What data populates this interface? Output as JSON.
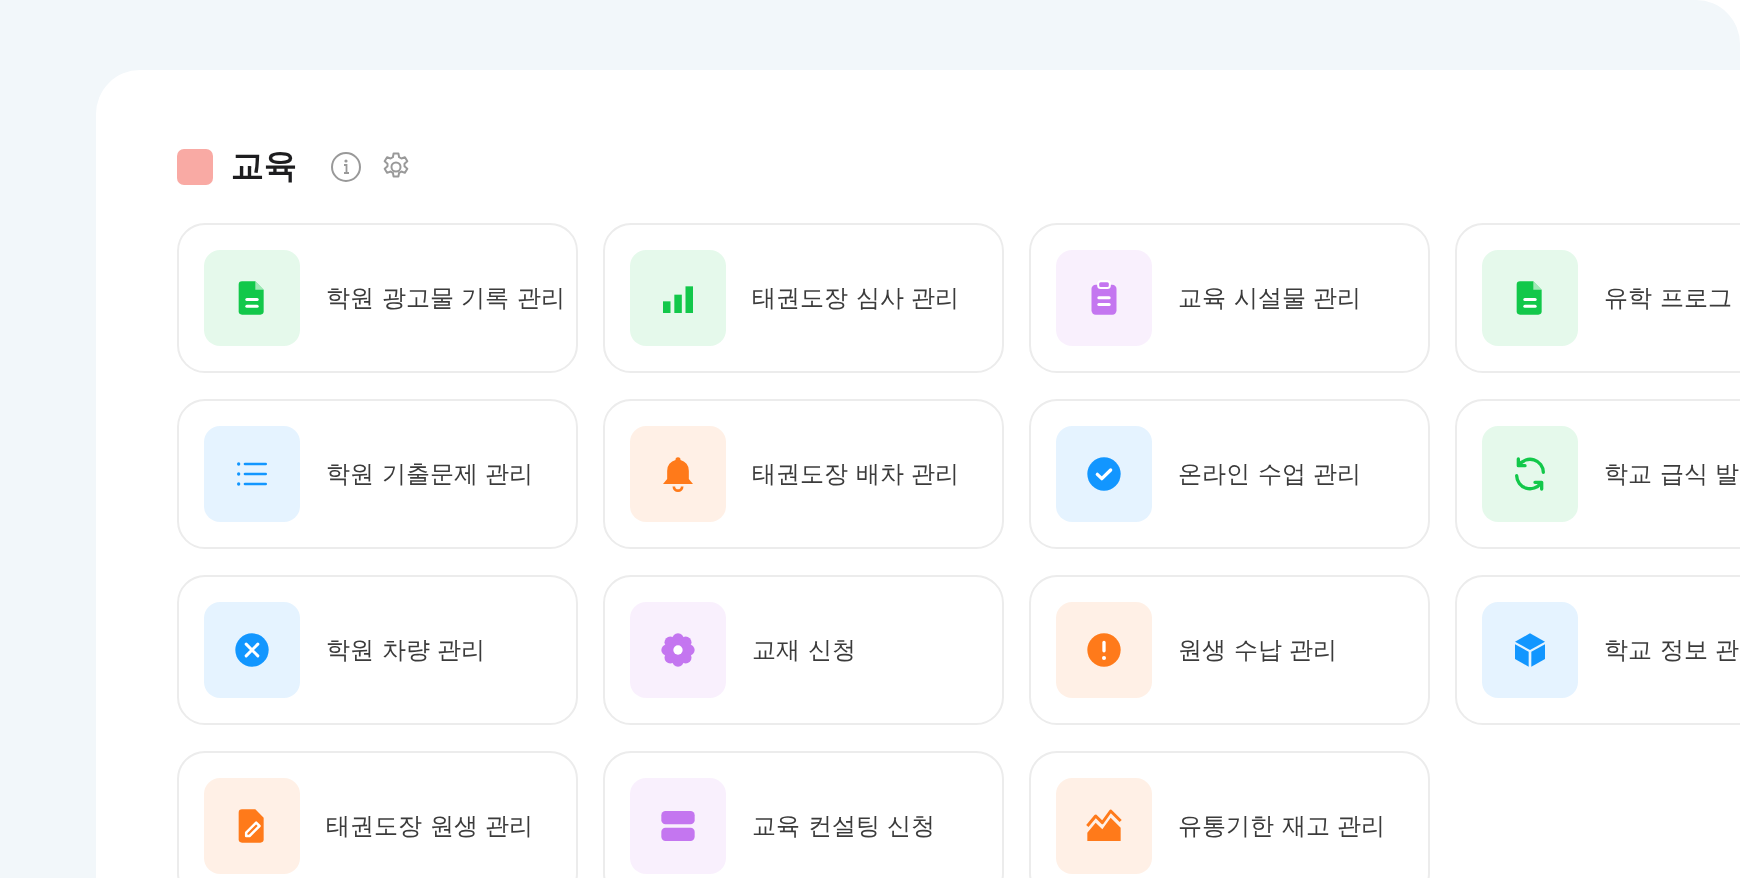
{
  "section": {
    "title": "교육",
    "color": "#f9aaa4"
  },
  "items": [
    {
      "label": "학원 광고물 기록 관리",
      "kind": "document",
      "color": "#12c84a"
    },
    {
      "label": "태권도장 심사 관리",
      "kind": "bars",
      "color": "#12c84a"
    },
    {
      "label": "교육 시설물 관리",
      "kind": "clipboard",
      "color": "#c476f0"
    },
    {
      "label": "유학 프로그",
      "kind": "document",
      "color": "#12c84a"
    },
    {
      "label": "학원 기출문제 관리",
      "kind": "list",
      "color": "#1296ff"
    },
    {
      "label": "태권도장 배차 관리",
      "kind": "bell",
      "color": "#ff7a1a"
    },
    {
      "label": "온라인 수업 관리",
      "kind": "check",
      "color": "#1296ff"
    },
    {
      "label": "학교 급식 발",
      "kind": "refresh",
      "color": "#12c84a"
    },
    {
      "label": "학원 차량 관리",
      "kind": "cross",
      "color": "#1296ff"
    },
    {
      "label": "교재 신청",
      "kind": "flower",
      "color": "#c476f0"
    },
    {
      "label": "원생 수납 관리",
      "kind": "alert",
      "color": "#ff7a1a"
    },
    {
      "label": "학교 정보 관",
      "kind": "cube",
      "color": "#1296ff"
    },
    {
      "label": "태권도장 원생 관리",
      "kind": "edit",
      "color": "#ff7a1a"
    },
    {
      "label": "교육 컨설팅 신청",
      "kind": "stack",
      "color": "#c476f0"
    },
    {
      "label": "유통기한 재고 관리",
      "kind": "area",
      "color": "#ff7a1a"
    }
  ]
}
